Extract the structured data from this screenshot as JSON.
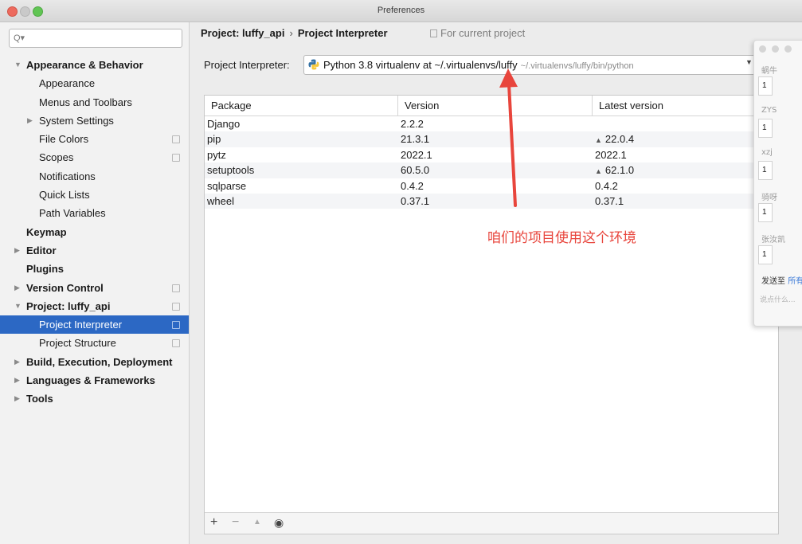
{
  "window": {
    "title": "Preferences"
  },
  "sidebar": {
    "search": {
      "placeholder": "",
      "value": ""
    },
    "items": [
      {
        "label": "Appearance & Behavior",
        "level": 0,
        "bold": true,
        "expander": "expanded",
        "copy": false
      },
      {
        "label": "Appearance",
        "level": 1,
        "bold": false,
        "expander": "none",
        "copy": false
      },
      {
        "label": "Menus and Toolbars",
        "level": 1,
        "bold": false,
        "expander": "none",
        "copy": false
      },
      {
        "label": "System Settings",
        "level": 1,
        "bold": false,
        "expander": "collapsed",
        "copy": false
      },
      {
        "label": "File Colors",
        "level": 1,
        "bold": false,
        "expander": "none",
        "copy": true
      },
      {
        "label": "Scopes",
        "level": 1,
        "bold": false,
        "expander": "none",
        "copy": true
      },
      {
        "label": "Notifications",
        "level": 1,
        "bold": false,
        "expander": "none",
        "copy": false
      },
      {
        "label": "Quick Lists",
        "level": 1,
        "bold": false,
        "expander": "none",
        "copy": false
      },
      {
        "label": "Path Variables",
        "level": 1,
        "bold": false,
        "expander": "none",
        "copy": false
      },
      {
        "label": "Keymap",
        "level": 0,
        "bold": true,
        "expander": "none",
        "copy": false
      },
      {
        "label": "Editor",
        "level": 0,
        "bold": true,
        "expander": "collapsed",
        "copy": false
      },
      {
        "label": "Plugins",
        "level": 0,
        "bold": true,
        "expander": "none",
        "copy": false
      },
      {
        "label": "Version Control",
        "level": 0,
        "bold": true,
        "expander": "collapsed",
        "copy": true
      },
      {
        "label": "Project: luffy_api",
        "level": 0,
        "bold": true,
        "expander": "expanded",
        "copy": true
      },
      {
        "label": "Project Interpreter",
        "level": 1,
        "bold": false,
        "expander": "none",
        "copy": true,
        "selected": true
      },
      {
        "label": "Project Structure",
        "level": 1,
        "bold": false,
        "expander": "none",
        "copy": true
      },
      {
        "label": "Build, Execution, Deployment",
        "level": 0,
        "bold": true,
        "expander": "collapsed",
        "copy": false
      },
      {
        "label": "Languages & Frameworks",
        "level": 0,
        "bold": true,
        "expander": "collapsed",
        "copy": false
      },
      {
        "label": "Tools",
        "level": 0,
        "bold": true,
        "expander": "collapsed",
        "copy": false
      }
    ]
  },
  "breadcrumb": {
    "project": "Project: luffy_api",
    "separator": "›",
    "page": "Project Interpreter"
  },
  "scope_label": "For current project",
  "interpreter": {
    "label": "Project Interpreter:",
    "value": "Python 3.8 virtualenv at ~/.virtualenvs/luffy",
    "path": "~/.virtualenvs/luffy/bin/python"
  },
  "packages": {
    "columns": [
      "Package",
      "Version",
      "Latest version"
    ],
    "rows": [
      {
        "package": "Django",
        "version": "2.2.2",
        "latest": "",
        "upgrade": false
      },
      {
        "package": "pip",
        "version": "21.3.1",
        "latest": "22.0.4",
        "upgrade": true
      },
      {
        "package": "pytz",
        "version": "2022.1",
        "latest": "2022.1",
        "upgrade": false
      },
      {
        "package": "setuptools",
        "version": "60.5.0",
        "latest": "62.1.0",
        "upgrade": true
      },
      {
        "package": "sqlparse",
        "version": "0.4.2",
        "latest": "0.4.2",
        "upgrade": false
      },
      {
        "package": "wheel",
        "version": "0.37.1",
        "latest": "0.37.1",
        "upgrade": false
      }
    ]
  },
  "toolbar": {
    "add": "+",
    "remove": "−",
    "upgrade": "▲",
    "show": "◉"
  },
  "annotation": {
    "text": "咱们的项目使用这个环境",
    "color": "#e8453c"
  },
  "chat": {
    "names": [
      "蜗牛",
      "ZYS",
      "xzj",
      "骑呀",
      "张汝凯"
    ],
    "counts": [
      "1",
      "1",
      "1",
      "1",
      "1"
    ],
    "send_prefix": "发送至",
    "send_target": "所有",
    "input_hint": "说点什么..."
  },
  "colors": {
    "selection": "#2c68c4",
    "accent_link": "#3d7bd8"
  }
}
